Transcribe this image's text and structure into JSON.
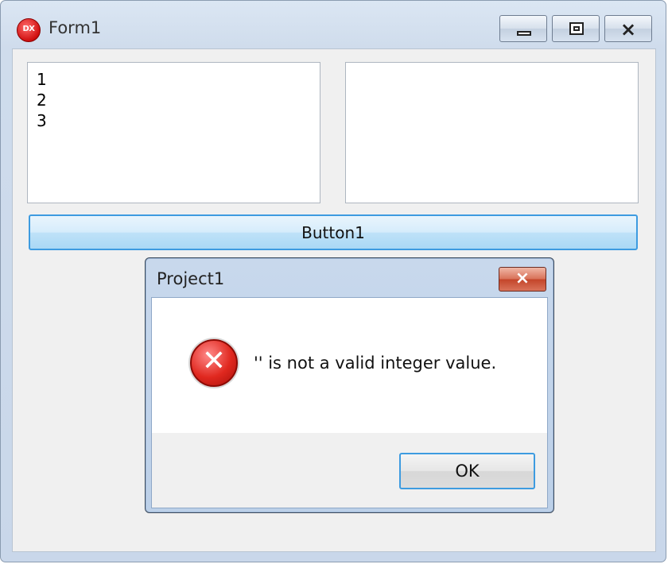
{
  "window": {
    "title": "Form1",
    "icon_text": "DX",
    "icon": "app-icon",
    "controls": {
      "minimize": "minimize-icon",
      "maximize": "maximize-icon",
      "close": "×"
    }
  },
  "listbox_left": {
    "items": [
      "1",
      "2",
      "3"
    ]
  },
  "listbox_right": {
    "items": []
  },
  "button1": {
    "label": "Button1"
  },
  "dialog": {
    "title": "Project1",
    "close_glyph": "×",
    "icon": "error-icon",
    "icon_glyph": "✕",
    "message": "'' is not a valid integer value.",
    "ok_label": "OK"
  },
  "colors": {
    "accent": "#3d9be0",
    "error_red": "#e0281f"
  }
}
